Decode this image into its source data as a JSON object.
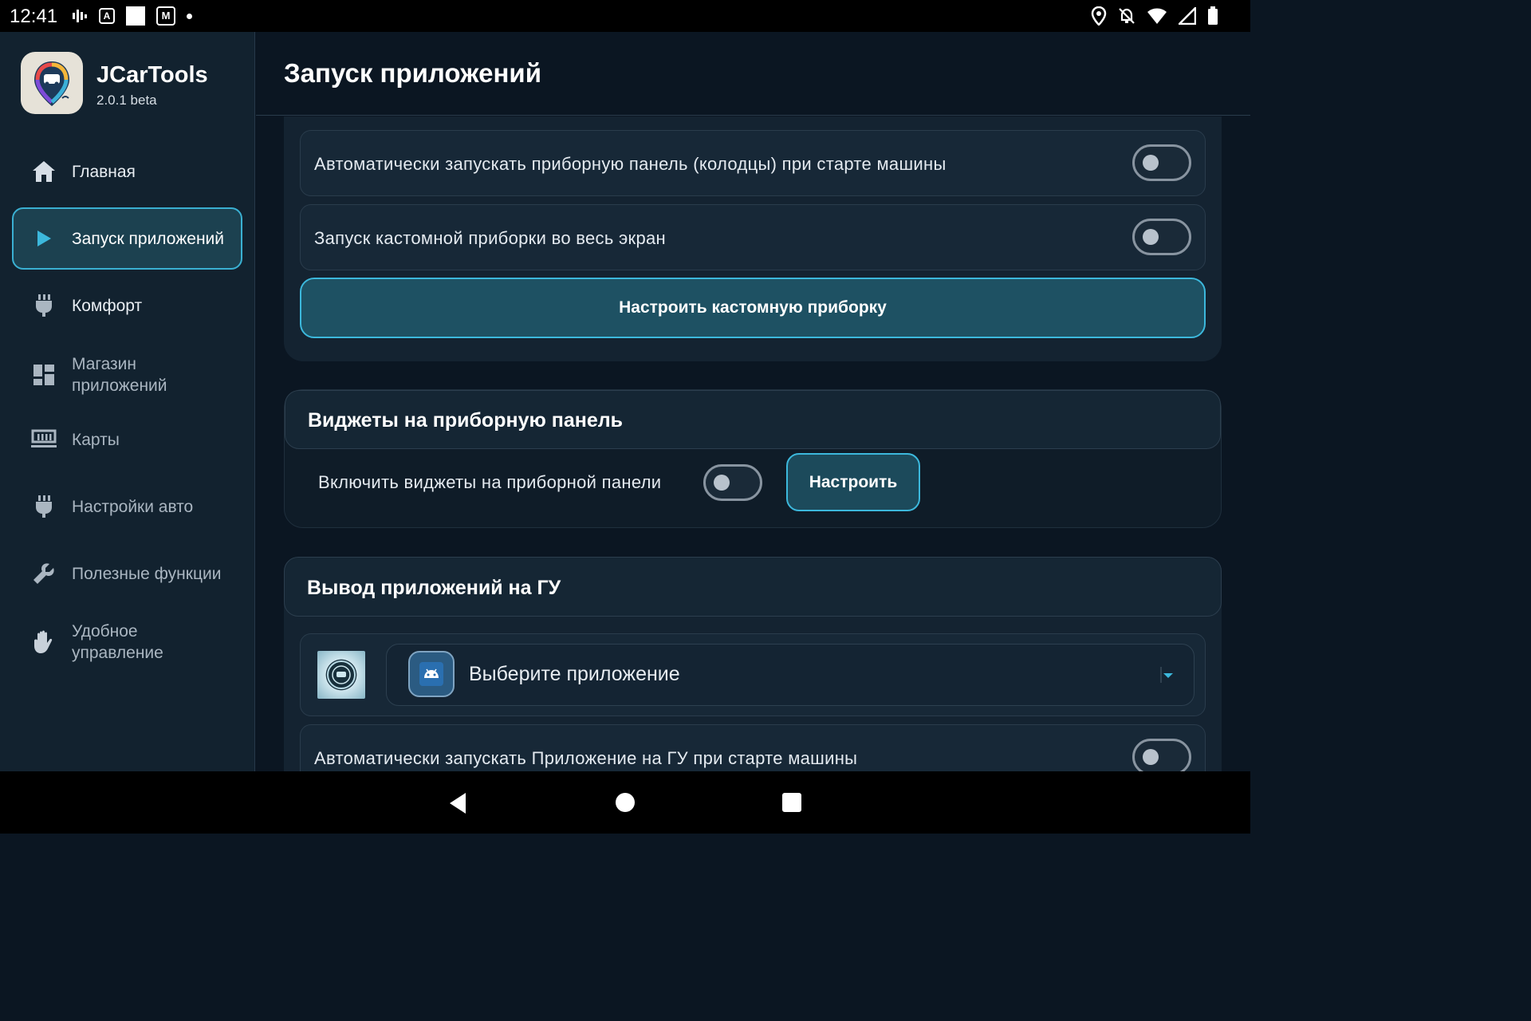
{
  "status_bar": {
    "time": "12:41",
    "left_icons": [
      "signal-activity-icon",
      "font-a-icon",
      "white-square-icon",
      "app-notification-icon",
      "dot-icon"
    ],
    "right_icons": [
      "location-icon",
      "notifications-off-icon",
      "wifi-icon",
      "cell-signal-icon",
      "battery-icon"
    ]
  },
  "app": {
    "name": "JCarTools",
    "version": "2.0.1 beta"
  },
  "sidebar": {
    "items": [
      {
        "label": "Главная",
        "icon": "home-icon"
      },
      {
        "label": "Запуск приложений",
        "icon": "play-icon",
        "active": true
      },
      {
        "label": "Комфорт",
        "icon": "plug-icon"
      },
      {
        "label": "Магазин приложений",
        "icon": "dashboard-icon"
      },
      {
        "label": "Карты",
        "icon": "map-icon"
      },
      {
        "label": "Настройки авто",
        "icon": "plug-icon"
      },
      {
        "label": "Полезные функции",
        "icon": "wrench-icon"
      },
      {
        "label": "Удобное управление",
        "icon": "hand-icon"
      }
    ]
  },
  "header": {
    "title": "Запуск приложений"
  },
  "main": {
    "dashboard_autostart": {
      "label": "Автоматически запускать приборную панель (колодцы) при старте машины",
      "enabled": false
    },
    "custom_fullscreen": {
      "label": "Запуск кастомной приборки во весь экран",
      "enabled": false
    },
    "configure_custom_button": "Настроить кастомную приборку",
    "widgets_section": {
      "title": "Виджеты на приборную панель",
      "enable_label": "Включить виджеты на приборной панели",
      "enabled": false,
      "configure_button": "Настроить"
    },
    "head_unit_section": {
      "title": "Вывод приложений на ГУ",
      "app_select_placeholder": "Выберите приложение",
      "autostart_label": "Автоматически запускать Приложение на ГУ при старте машины",
      "autostart_enabled": false
    }
  },
  "colors": {
    "accent": "#3cb8dc",
    "background": "#0b1622",
    "sidebar": "#12222f"
  }
}
